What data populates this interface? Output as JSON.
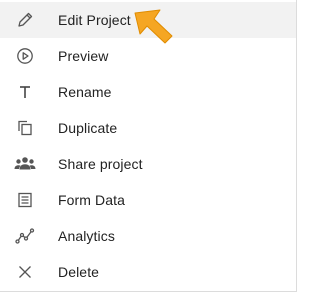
{
  "menu": {
    "items": [
      {
        "label": "Edit Project",
        "icon": "pencil-icon",
        "active": true
      },
      {
        "label": "Preview",
        "icon": "play-circle-icon"
      },
      {
        "label": "Rename",
        "icon": "text-t-icon"
      },
      {
        "label": "Duplicate",
        "icon": "duplicate-icon"
      },
      {
        "label": "Share project",
        "icon": "people-icon"
      },
      {
        "label": "Form Data",
        "icon": "list-icon"
      },
      {
        "label": "Analytics",
        "icon": "analytics-icon"
      },
      {
        "label": "Delete",
        "icon": "close-x-icon"
      }
    ]
  },
  "colors": {
    "text": "#222222",
    "icon": "#555555",
    "hover_bg": "#f2f2f2",
    "pointer_arrow": "#f5a623"
  }
}
